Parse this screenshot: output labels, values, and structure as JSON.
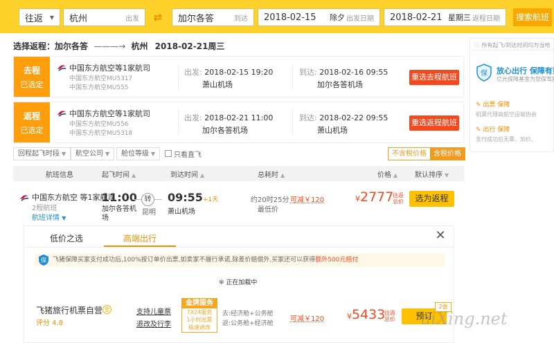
{
  "search": {
    "trip_type": "往返",
    "from_city": "杭州",
    "from_label": "出发",
    "to_city": "加尔各答",
    "to_label": "到达",
    "depart_date": "2018-02-15",
    "depart_weekday": "除夕",
    "depart_label": "出发日期",
    "return_date": "2018-02-21",
    "return_weekday": "星期三",
    "return_label": "返程日期",
    "search_button": "搜索航班"
  },
  "route_title": {
    "prefix": "选择返程：加尔各答",
    "arrow": "———→",
    "dest": "杭州",
    "date": "2018-02-21周三"
  },
  "selected": [
    {
      "tag": "去程",
      "tag_sub": "已选定",
      "airline": "中国东方航空等1家航司",
      "flight1": "中国东方航空MU5317",
      "flight2": "中国东方航空MU555",
      "dep_label": "出发:",
      "dep_time": "2018-02-15 19:20",
      "dep_airport": "萧山机场",
      "arr_label": "到达:",
      "arr_time": "2018-02-16 09:55",
      "arr_airport": "加尔各答机场",
      "button": "重选去程航班"
    },
    {
      "tag": "返程",
      "tag_sub": "已选定",
      "airline": "中国东方航空等1家航司",
      "flight1": "中国东方航空MU556",
      "flight2": "中国东方航空MU5318",
      "dep_label": "出发:",
      "dep_time": "2018-02-21 11:00",
      "dep_airport": "加尔各答机场",
      "arr_label": "到达:",
      "arr_time": "2018-02-22 09:55",
      "arr_airport": "萧山机场",
      "button": "重选返程航班"
    }
  ],
  "rightcol": {
    "note": "所有起飞/到达时间均为当地",
    "title": "放心出行 保障有到",
    "subtitle": "亿元保障基金为您保驾护",
    "items": [
      {
        "title": "出票 保障",
        "desc": "机票代理商航空运输协会"
      },
      {
        "title": "出行 保障",
        "desc": "支付成功后无票、加价、"
      }
    ]
  },
  "filters": {
    "items": [
      "回程起飞时段",
      "航空公司",
      "舱位等级"
    ],
    "direct_only": "只看直飞",
    "tax_excl": "不含税价格",
    "tax_incl": "含税价格"
  },
  "table_header": {
    "info": "航班信息",
    "dep": "起飞时间",
    "arr": "到达时间",
    "total": "总耗时",
    "price": "价格",
    "sort": "默认排序"
  },
  "result": {
    "airline": "中国东方航空 等1家航司",
    "segments": "2程航班",
    "detail": "航班详情",
    "dep_time": "11:00",
    "dep_airport": "加尔各答机",
    "dep_airport2": "场",
    "stop_mark": "转",
    "stop_city": "昆明",
    "arr_time": "09:55",
    "plus_day": "+1天",
    "arr_airport": "萧山机场",
    "duration": "约20时25分",
    "lowest": "最低价",
    "reduce": "可减￥120",
    "currency": "¥",
    "price": "2777",
    "tax1": "往返",
    "tax2": "总价",
    "button": "选为返程"
  },
  "panel": {
    "tab_low": "低价之选",
    "tab_high": "高端出行",
    "close": "✕",
    "notice_pre": "飞猪保障买家支付成功后,100%按订单价出票,如卖家不履行承诺,除差价赔偿外,买家还可以获得",
    "notice_hl": "额外500元赔付",
    "loading": "正在加载中",
    "vendor": "飞猪旅行机票自营",
    "vendor_badge": "金",
    "rating": "评分 4.8",
    "service1": "支持儿童票",
    "service2": "退改及行李",
    "gold_title": "金牌服务",
    "gold_lines": [
      "7X24服务",
      "1小时出票",
      "极速退改"
    ],
    "desc1": "去:经济舱+公务舱",
    "desc2": "返:公务舱+经济舱",
    "reduce": "可减￥120",
    "currency": "¥",
    "price": "5433",
    "tax1": "往返",
    "tax2": "总价",
    "button": "预订",
    "badge": "2张"
  },
  "watermark": "aiXing.net",
  "colors": {
    "brand_yellow": "#ffd22b",
    "tag_orange": "#ff9e0d",
    "action_red": "#f24a1e",
    "button_yellow": "#ffc000"
  }
}
